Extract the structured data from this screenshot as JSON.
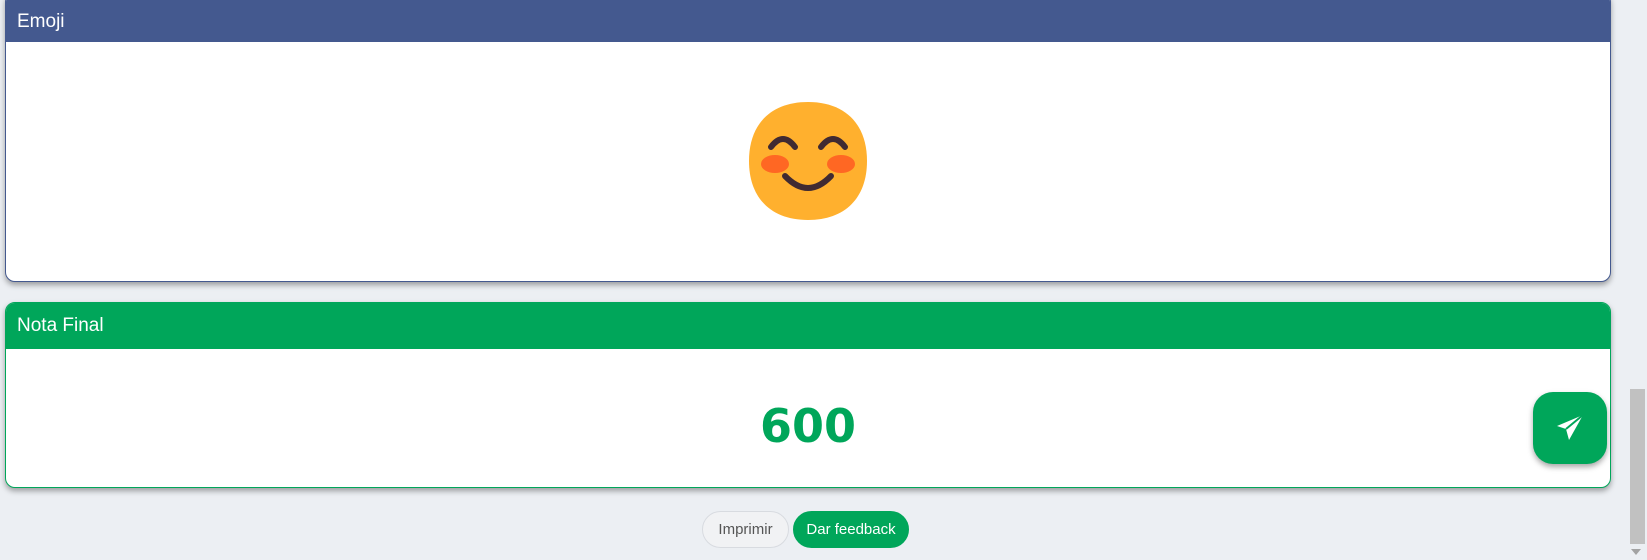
{
  "emoji_card": {
    "title": "Emoji",
    "emoji_name": "smiling-face-with-smiling-eyes-icon",
    "header_color": "#44598f"
  },
  "nota_card": {
    "title": "Nota Final",
    "value": "600",
    "header_color": "#00a65a"
  },
  "send_button": {
    "icon": "paper-plane-icon"
  },
  "actions": {
    "print_label": "Imprimir",
    "feedback_label": "Dar feedback"
  },
  "colors": {
    "primary_green": "#00a65a",
    "header_blue": "#44598f",
    "background": "#eceff3"
  }
}
